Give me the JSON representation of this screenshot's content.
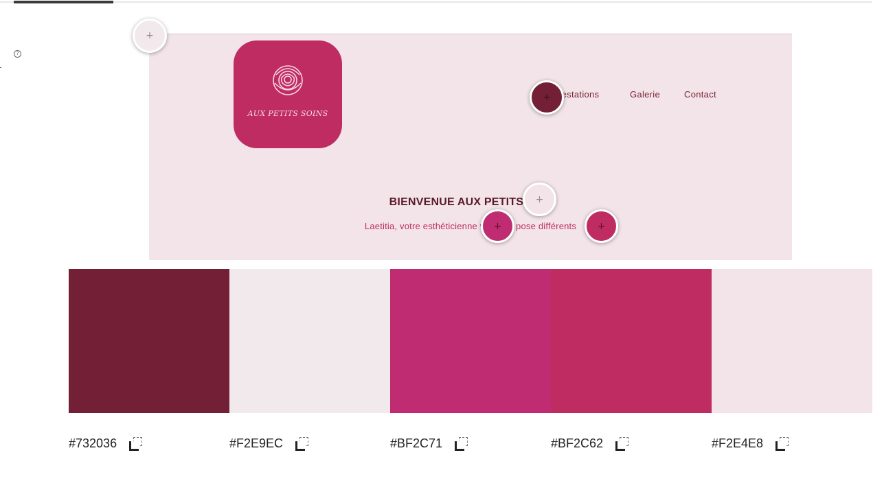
{
  "help": {
    "symbol": "?"
  },
  "preview": {
    "logo": {
      "text": "AUX PETITS SOINS",
      "icon": "rose-icon"
    },
    "nav": [
      "restations",
      "Galerie",
      "Contact"
    ],
    "hero": {
      "title": "BIENVENUE AUX PETITS    NS",
      "subtitle": "Laetitia, votre esthéticienne vo          pose différents"
    }
  },
  "pickers": {
    "symbol": "+"
  },
  "palette": [
    {
      "hex": "#732036",
      "code": "#732036"
    },
    {
      "hex": "#F2E9EC",
      "code": "#F2E9EC"
    },
    {
      "hex": "#BF2C71",
      "code": "#BF2C71"
    },
    {
      "hex": "#BF2C62",
      "code": "#BF2C62"
    },
    {
      "hex": "#F2E4E8",
      "code": "#F2E4E8"
    }
  ]
}
